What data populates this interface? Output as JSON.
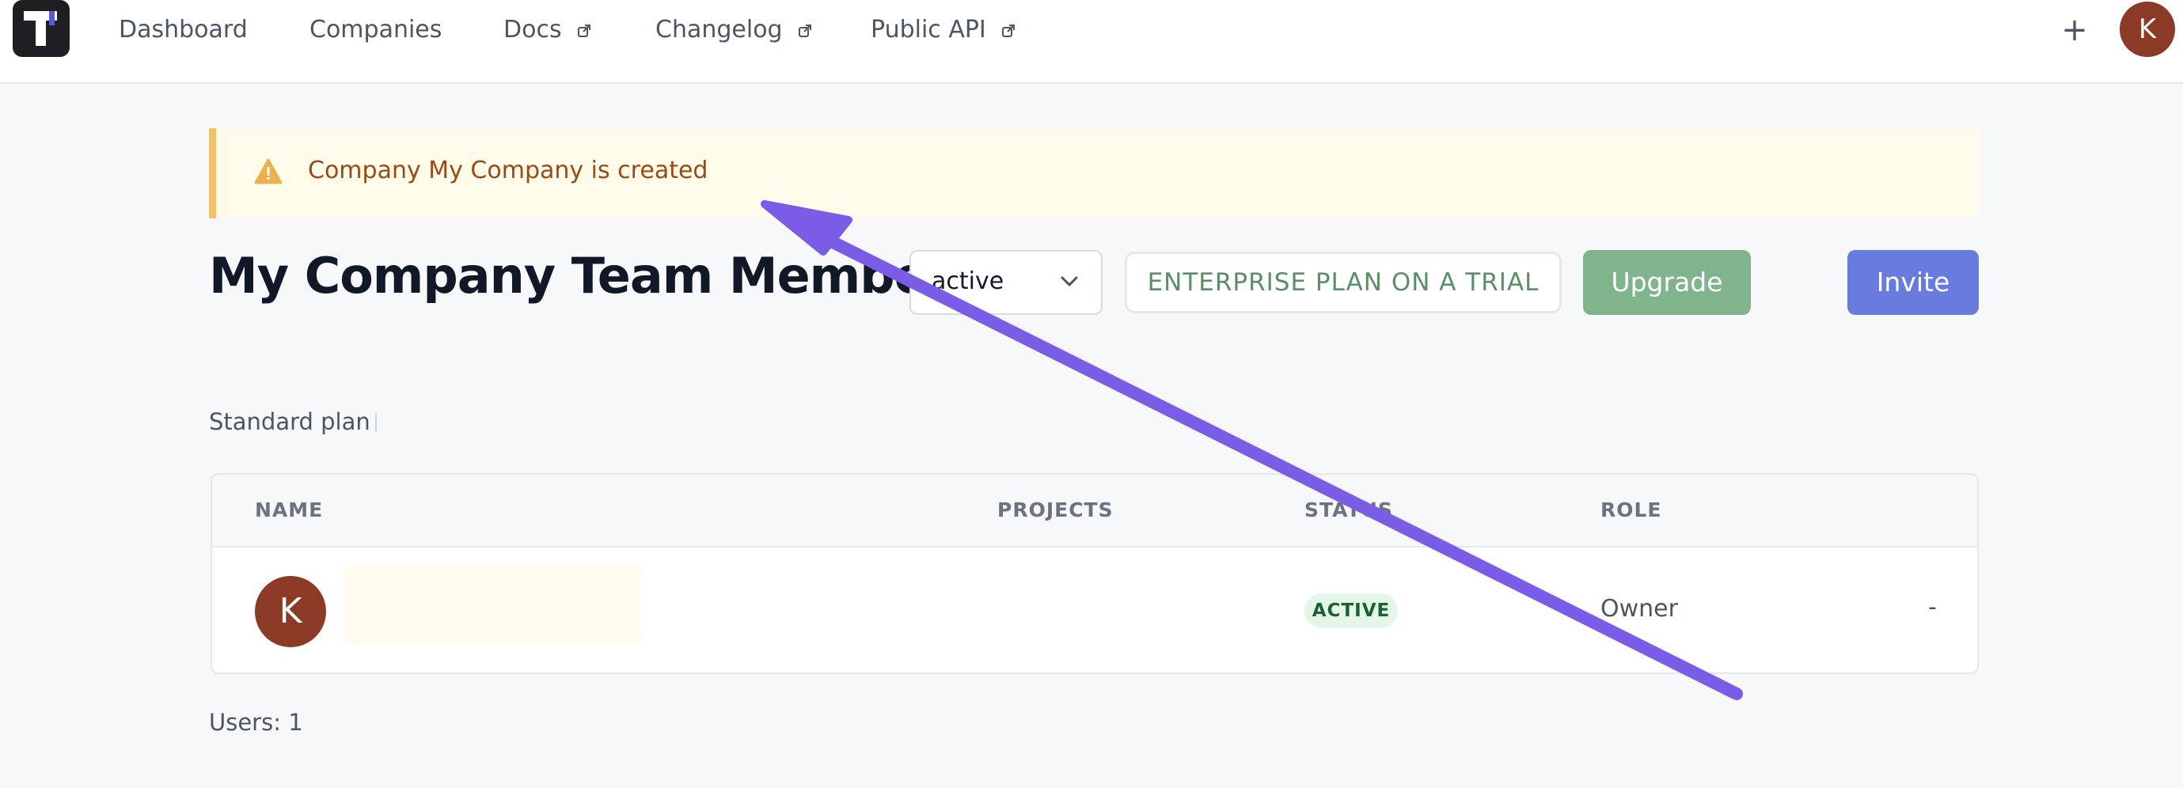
{
  "nav": {
    "items": [
      {
        "label": "Dashboard",
        "external": false
      },
      {
        "label": "Companies",
        "external": false
      },
      {
        "label": "Docs",
        "external": true
      },
      {
        "label": "Changelog",
        "external": true
      },
      {
        "label": "Public API",
        "external": true
      }
    ],
    "add_label": "+",
    "user_initial": "K"
  },
  "alert": {
    "text": "Company My Company is created",
    "icon": "warning-icon"
  },
  "header": {
    "title": "My Company Team Members",
    "status_filter": "active",
    "plan_badge": "ENTERPRISE PLAN ON A TRIAL",
    "upgrade_label": "Upgrade",
    "invite_label": "Invite"
  },
  "plan_label": "Standard plan",
  "table": {
    "columns": [
      "NAME",
      "PROJECTS",
      "STATUS",
      "ROLE"
    ],
    "rows": [
      {
        "initial": "K",
        "status": "ACTIVE",
        "role": "Owner",
        "action": "-"
      }
    ]
  },
  "footer": {
    "users_count": "Users: 1"
  },
  "colors": {
    "accent": "#6a7be0",
    "upgrade": "#7fb48c",
    "alert_bg": "#fefbeb",
    "alert_border": "#f0c06a",
    "avatar": "#8b3a26",
    "annotation_arrow": "#7b5ce6"
  }
}
